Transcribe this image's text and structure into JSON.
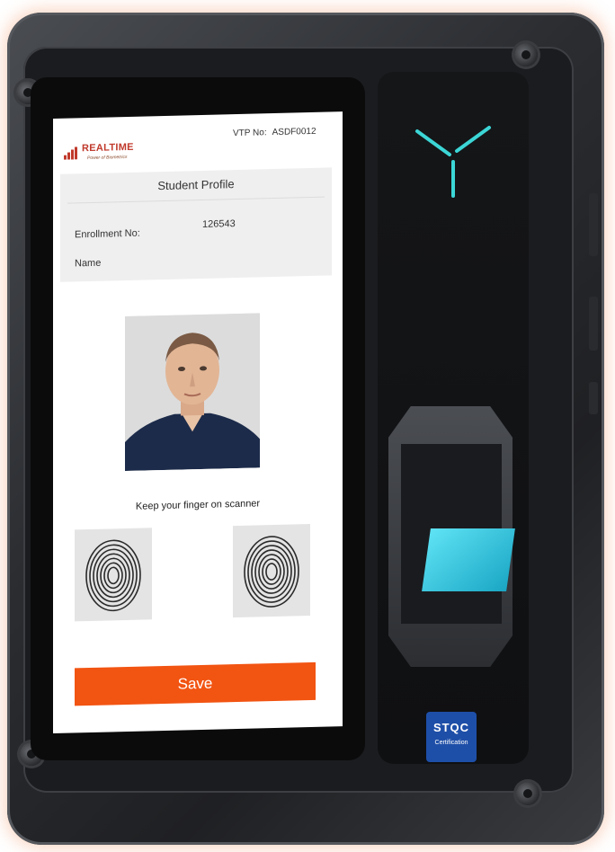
{
  "header": {
    "logo_text": "REALTIME",
    "logo_tagline": "Power of Biometrics",
    "vtp_label": "VTP No:",
    "vtp_value": "ASDF0012"
  },
  "profile": {
    "title": "Student Profile",
    "enrollment_label": "Enrollment No:",
    "enrollment_value": "126543",
    "name_label": "Name",
    "name_value": ""
  },
  "scan": {
    "instruction": "Keep your finger on scanner"
  },
  "actions": {
    "save_label": "Save"
  },
  "device": {
    "badge_top": "STQC",
    "badge_bottom": "Certification"
  },
  "colors": {
    "accent": "#f25412",
    "led": "#3cd6d6",
    "scanner_glass": "#3fcde3",
    "badge": "#1e4fa8"
  }
}
